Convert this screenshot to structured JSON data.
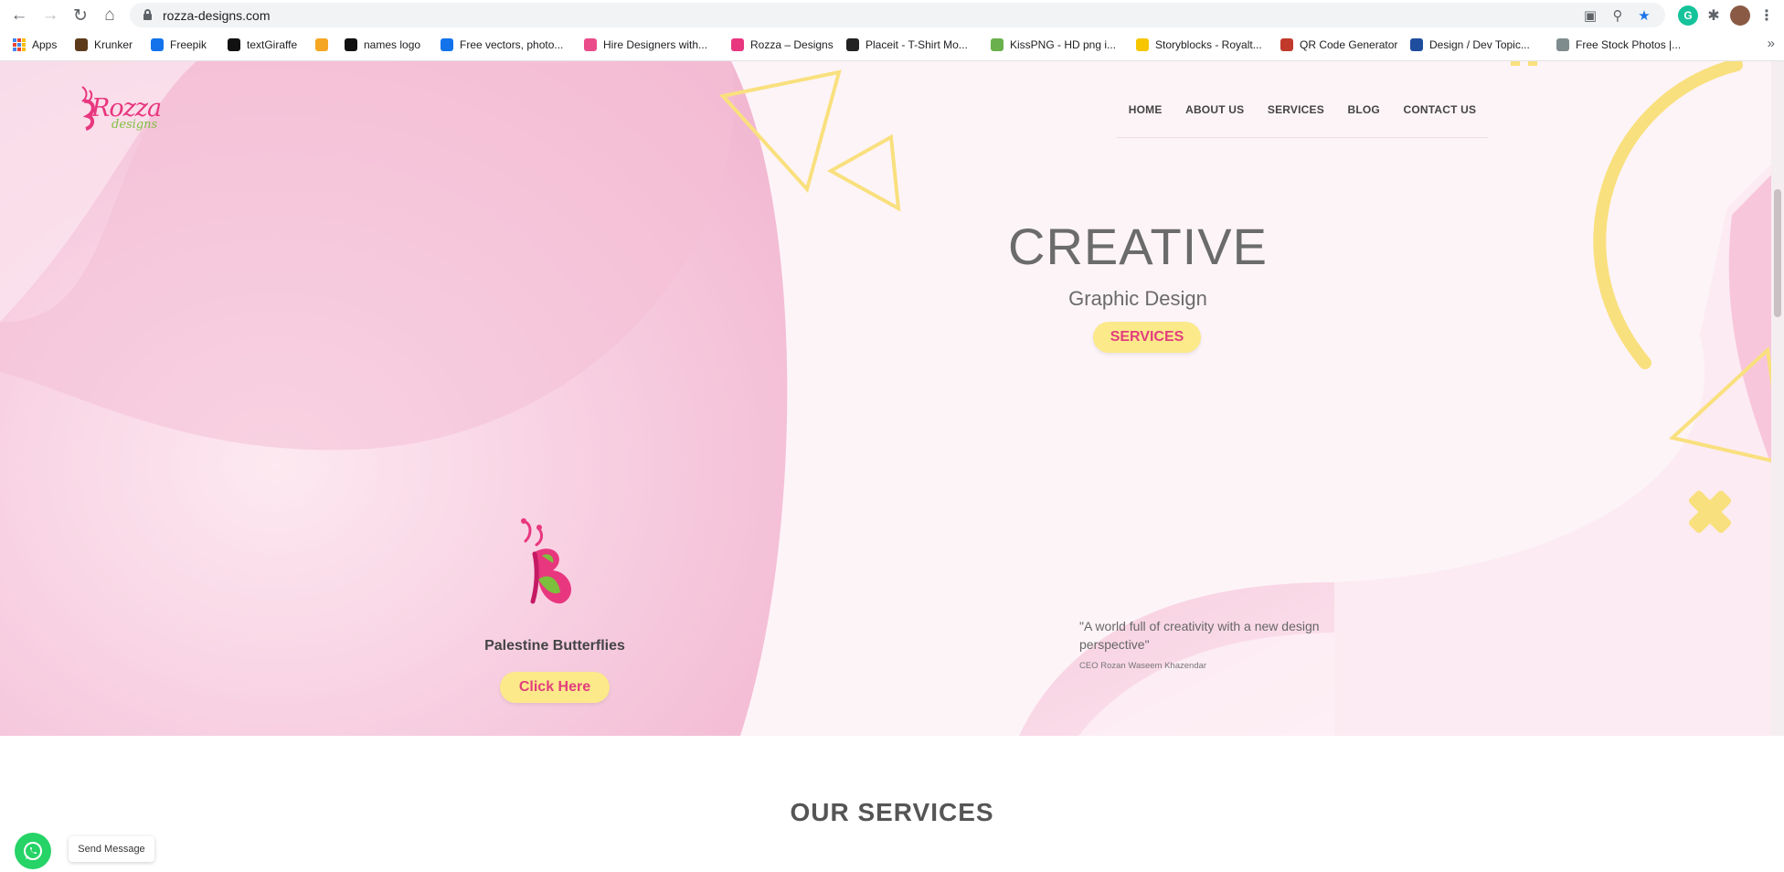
{
  "browser": {
    "url": "rozza-designs.com",
    "bookmarks": [
      {
        "label": "Apps",
        "icon": "apps-grid-icon",
        "color": "#4285f4"
      },
      {
        "label": "Krunker",
        "icon": "krunker-icon",
        "color": "#5d3a1a"
      },
      {
        "label": "Freepik",
        "icon": "freepik-icon",
        "color": "#1273eb"
      },
      {
        "label": "textGiraffe",
        "icon": "textgiraffe-icon",
        "color": "#111111"
      },
      {
        "label": "",
        "icon": "bookmark-orange-icon",
        "color": "#f5a623"
      },
      {
        "label": "names logo",
        "icon": "names-logo-icon",
        "color": "#111111"
      },
      {
        "label": "Free vectors, photo...",
        "icon": "freepik-icon",
        "color": "#1273eb"
      },
      {
        "label": "Hire Designers with...",
        "icon": "dribbble-icon",
        "color": "#ea4c89"
      },
      {
        "label": "Rozza – Designs",
        "icon": "rozza-icon",
        "color": "#e8377f"
      },
      {
        "label": "Placeit - T-Shirt Mo...",
        "icon": "placeit-icon",
        "color": "#222222"
      },
      {
        "label": "KissPNG - HD png i...",
        "icon": "kisspng-icon",
        "color": "#6ab04c"
      },
      {
        "label": "Storyblocks - Royalt...",
        "icon": "storyblocks-icon",
        "color": "#f7c600"
      },
      {
        "label": "QR Code Generator",
        "icon": "qr-icon",
        "color": "#c0392b"
      },
      {
        "label": "Design / Dev Topic...",
        "icon": "design-dev-icon",
        "color": "#1f4e9e"
      },
      {
        "label": "Free Stock Photos |...",
        "icon": "stock-photos-icon",
        "color": "#7f8c8d"
      }
    ],
    "more_label": "»"
  },
  "site": {
    "logo_text": "Rozza",
    "logo_sub": "designs",
    "nav": [
      "HOME",
      "ABOUT US",
      "SERVICES",
      "BLOG",
      "CONTACT US"
    ],
    "hero_title": "CREATIVE",
    "hero_subtitle": "Graphic Design",
    "hero_button": "SERVICES",
    "butterfly_caption": "Palestine Butterflies",
    "click_button": "Click Here",
    "quote": "\"A world full of creativity with a new design perspective\"",
    "quote_author": "CEO Rozan Waseem Khazendar",
    "section_title": "OUR SERVICES",
    "whatsapp_label": "Send Message"
  },
  "colors": {
    "brand_pink": "#e8377f",
    "brand_green": "#7cbf3d",
    "button_yellow": "#fbe98a",
    "shape_yellow": "#f9e07e",
    "whatsapp_green": "#25d366"
  }
}
